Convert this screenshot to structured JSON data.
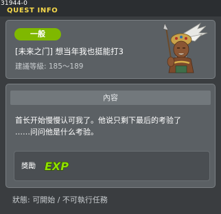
{
  "window": {
    "quest_id": "31944-0",
    "title": "QUEST INFO"
  },
  "quest": {
    "category": "一般",
    "name": "[未来之门] 想当年我也挺能打3",
    "level_requirement": "建議等級: 185～189"
  },
  "content": {
    "header": "內容",
    "description_line1": "首长开始慢慢认可我了。他说只剩下最后的考验了",
    "description_line2": "……问问他是什么考验。"
  },
  "reward": {
    "label": "獎勵",
    "exp_text": "EXP"
  },
  "status": {
    "text": "狀態:  可開始  / 不可執行任務"
  },
  "colors": {
    "title": "#f6d84a",
    "badge": "#7fb800",
    "exp_fill": "#8fe000"
  }
}
